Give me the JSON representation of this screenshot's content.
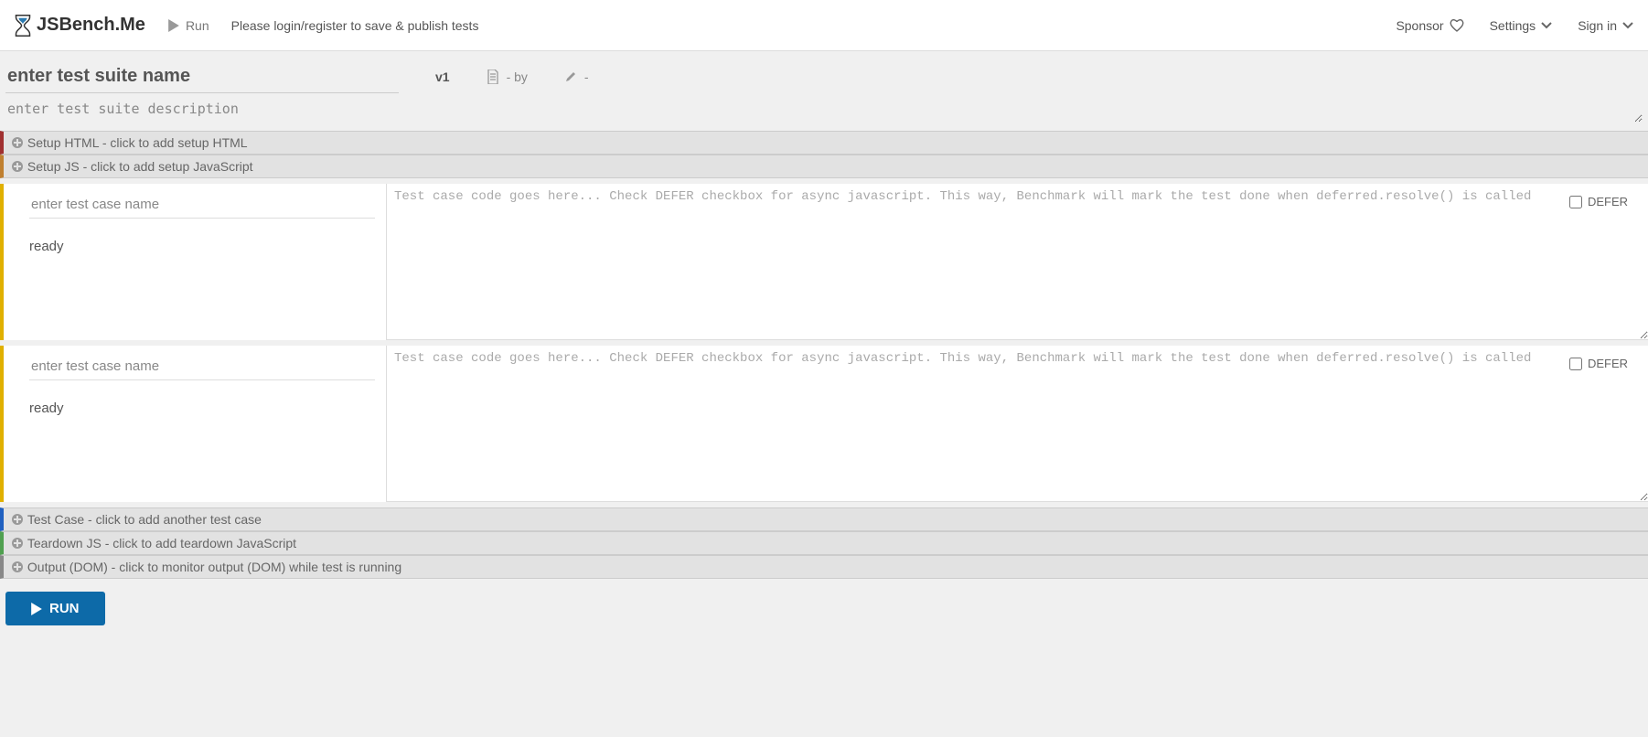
{
  "nav": {
    "brand": "JSBench.Me",
    "run": "Run",
    "login_msg": "Please login/register to save & publish tests",
    "sponsor": "Sponsor",
    "settings": "Settings",
    "signin": "Sign in"
  },
  "suite": {
    "name_placeholder": "enter test suite name",
    "name_value": "",
    "version": "v1",
    "by_label": "- by",
    "edit_label": "-",
    "desc_placeholder": "enter test suite description",
    "desc_value": ""
  },
  "bars": {
    "setup_html": "Setup HTML - click to add setup HTML",
    "setup_js": "Setup JS - click to add setup JavaScript",
    "add_testcase": "Test Case - click to add another test case",
    "teardown_js": "Teardown JS - click to add teardown JavaScript",
    "output_dom": "Output (DOM) - click to monitor output (DOM) while test is running"
  },
  "testcase_template": {
    "name_placeholder": "enter test case name",
    "status": "ready",
    "code_placeholder": "Test case code goes here... Check DEFER checkbox for async javascript. This way, Benchmark will mark the test done when deferred.resolve() is called",
    "defer_label": "DEFER"
  },
  "testcases": [
    {
      "name": "",
      "code": "",
      "defer": false
    },
    {
      "name": "",
      "code": "",
      "defer": false
    }
  ],
  "run_button": "RUN"
}
